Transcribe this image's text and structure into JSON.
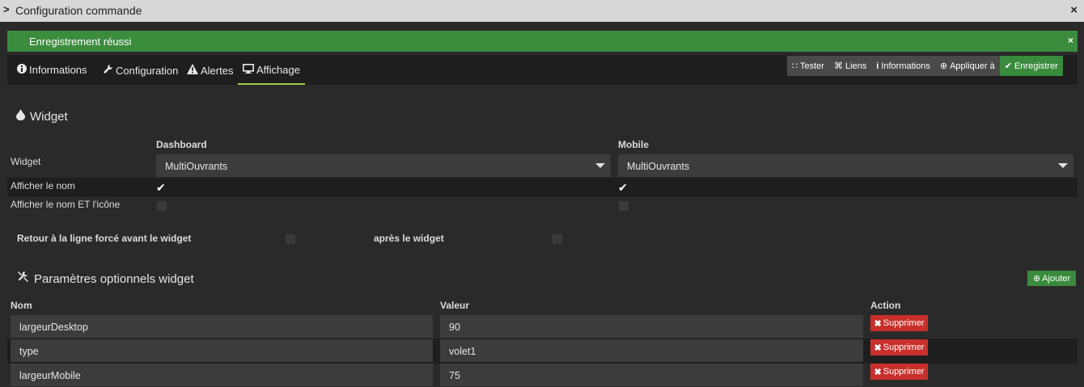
{
  "window": {
    "title": "Configuration commande",
    "close": "×",
    "chevron": ">"
  },
  "alert": {
    "text": "Enregistrement réussi",
    "close": "×"
  },
  "tabs": [
    {
      "label": "Informations",
      "icon": "info-circle-icon"
    },
    {
      "label": "Configuration",
      "icon": "wrench-icon"
    },
    {
      "label": "Alertes",
      "icon": "warning-icon"
    },
    {
      "label": "Affichage",
      "icon": "desktop-icon",
      "active": true
    }
  ],
  "toolbar": {
    "tester": "Tester",
    "liens": "Liens",
    "informations": "Informations",
    "appliquer": "Appliquer à",
    "enregistrer": "Enregistrer"
  },
  "widget_section": {
    "title": "Widget",
    "col_dashboard": "Dashboard",
    "col_mobile": "Mobile",
    "row_widget": "Widget",
    "dashboard_value": "MultiOuvrants",
    "mobile_value": "MultiOuvrants",
    "row_show_name": "Afficher le nom",
    "show_name_dashboard": true,
    "show_name_mobile": true,
    "row_show_name_icon": "Afficher le nom ET l'icône",
    "show_name_icon_dashboard": false,
    "show_name_icon_mobile": false,
    "line_break_before": "Retour à la ligne forcé avant le widget",
    "line_break_after": "après le widget"
  },
  "params_section": {
    "title": "Paramètres optionnels widget",
    "add_label": "Ajouter",
    "col_nom": "Nom",
    "col_valeur": "Valeur",
    "col_action": "Action",
    "delete_label": "Supprimer",
    "rows": [
      {
        "nom": "largeurDesktop",
        "valeur": "90"
      },
      {
        "nom": "type",
        "valeur": "volet1"
      },
      {
        "nom": "largeurMobile",
        "valeur": "75"
      }
    ]
  },
  "colors": {
    "success": "#3c8c3e",
    "danger": "#c9302c",
    "tab_underline": "#a2c94d",
    "background": "#2a2a2a"
  }
}
